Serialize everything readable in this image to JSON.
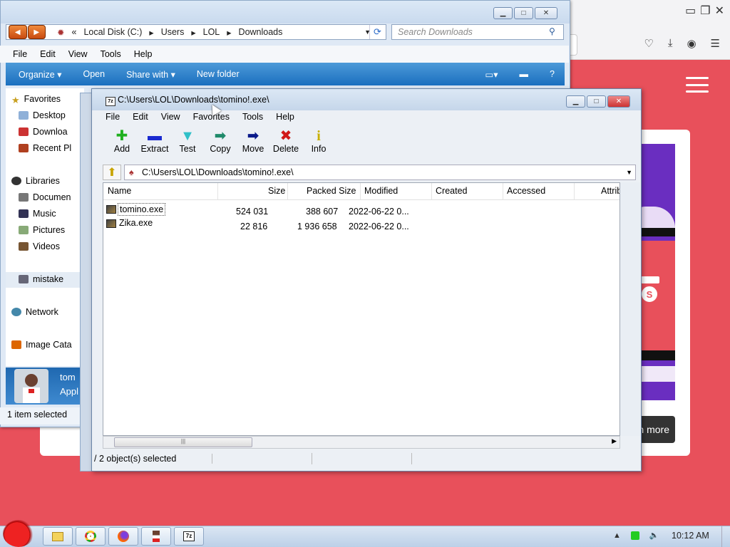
{
  "browser": {
    "learn_more": "rn more",
    "logo_char": "S"
  },
  "explorer": {
    "breadcrumb": [
      "«",
      "Local Disk (C:)",
      "Users",
      "LOL",
      "Downloads"
    ],
    "search_placeholder": "Search Downloads",
    "menu": [
      "File",
      "Edit",
      "View",
      "Tools",
      "Help"
    ],
    "toolbar": [
      "Organize ▾",
      "Open",
      "Share with ▾",
      "New folder"
    ],
    "nav": {
      "favorites": "Favorites",
      "desktop": "Desktop",
      "downloads": "Downloa",
      "recent": "Recent Pl",
      "libraries": "Libraries",
      "documents": "Documen",
      "music": "Music",
      "pictures": "Pictures",
      "videos": "Videos",
      "mistake": "mistake",
      "network": "Network",
      "image_catalog": "Image Cata"
    },
    "details_name": "tom",
    "details_type": "Appl",
    "status": "1 item selected"
  },
  "zip": {
    "title": "C:\\Users\\LOL\\Downloads\\tomino!.exe\\",
    "menu": [
      "File",
      "Edit",
      "View",
      "Favorites",
      "Tools",
      "Help"
    ],
    "toolbar": [
      {
        "label": "Add",
        "glyph": "✚",
        "color": "#1fb01f"
      },
      {
        "label": "Extract",
        "glyph": "▬",
        "color": "#1a2ad0"
      },
      {
        "label": "Test",
        "glyph": "▼",
        "color": "#30c0c8"
      },
      {
        "label": "Copy",
        "glyph": "➡",
        "color": "#1f8a6a"
      },
      {
        "label": "Move",
        "glyph": "➡",
        "color": "#0a1a8a"
      },
      {
        "label": "Delete",
        "glyph": "✖",
        "color": "#d01818"
      },
      {
        "label": "Info",
        "glyph": "i",
        "color": "#c8b000"
      }
    ],
    "path": "C:\\Users\\LOL\\Downloads\\tomino!.exe\\",
    "columns": [
      "Name",
      "Size",
      "Packed Size",
      "Modified",
      "Created",
      "Accessed",
      "Attribute"
    ],
    "rows": [
      {
        "name": "tomino.exe",
        "size": "524 031",
        "packed": "388 607",
        "modified": "2022-06-22 0..."
      },
      {
        "name": "Zika.exe",
        "size": "22 816",
        "packed": "1 936 658",
        "modified": "2022-06-22 0..."
      }
    ],
    "status": "/ 2 object(s) selected",
    "hscroll_grip": "|||"
  },
  "taskbar": {
    "clock": "10:12 AM"
  },
  "colors": {
    "page_bg": "#e8505b",
    "explorer_toolbar": "#1a6fbf",
    "site_panel": "#6a2ec0"
  }
}
